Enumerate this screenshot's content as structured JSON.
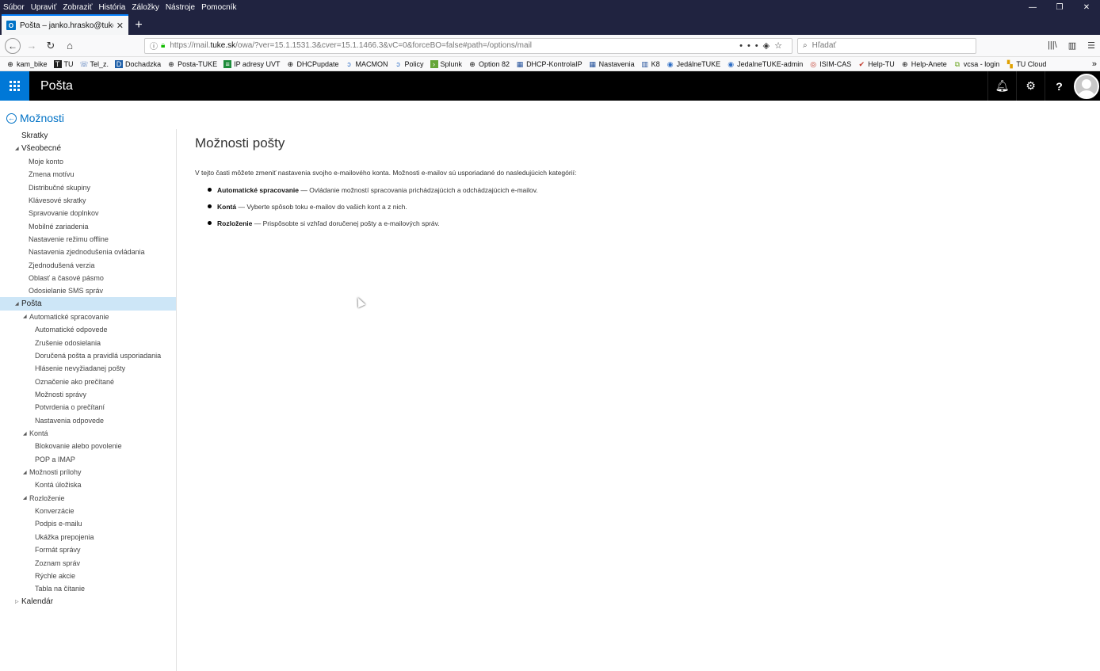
{
  "menubar": {
    "items": [
      "Súbor",
      "Upraviť",
      "Zobraziť",
      "História",
      "Záložky",
      "Nástroje",
      "Pomocník"
    ]
  },
  "tab": {
    "title": "Pošta – janko.hrasko@tuke.sk",
    "favicon": "O"
  },
  "address": {
    "url_pre": "https://mail.",
    "url_domain": "tuke.sk",
    "url_post": "/owa/?ver=15.1.1531.3&cver=15.1.1466.3&vC=0&forceBO=false#path=/options/mail"
  },
  "search": {
    "placeholder": "Hľadať"
  },
  "bookmarks": [
    "kam_bike",
    "TU",
    "Tel_z.",
    "Dochadzka",
    "Posta-TUKE",
    "IP adresy UVT",
    "DHCPupdate",
    "MACMON",
    "Policy",
    "Splunk",
    "Option 82",
    "DHCP-KontrolaIP",
    "Nastavenia",
    "K8",
    "JedálneTUKE",
    "JedalneTUKE-admin",
    "ISIM-CAS",
    "Help-TU",
    "Help-Anete",
    "vcsa - login",
    "TU Cloud"
  ],
  "owa": {
    "app_title": "Pošta",
    "back_label": "Možnosti"
  },
  "nav": {
    "skratky": "Skratky",
    "vseobecne": "Všeobecné",
    "vseobecne_items": [
      "Moje konto",
      "Zmena motívu",
      "Distribučné skupiny",
      "Klávesové skratky",
      "Spravovanie doplnkov",
      "Mobilné zariadenia",
      "Nastavenie režimu offline",
      "Nastavenia zjednodušenia ovládania",
      "Zjednodušená verzia",
      "Oblasť a časové pásmo",
      "Odosielanie SMS správ"
    ],
    "posta": "Pošta",
    "auto": "Automatické spracovanie",
    "auto_items": [
      "Automatické odpovede",
      "Zrušenie odosielania",
      "Doručená pošta a pravidlá usporiadania",
      "Hlásenie nevyžiadanej pošty",
      "Označenie ako prečítané",
      "Možnosti správy",
      "Potvrdenia o prečítaní",
      "Nastavenia odpovede"
    ],
    "konta": "Kontá",
    "konta_items": [
      "Blokovanie alebo povolenie",
      "POP a IMAP"
    ],
    "priloha": "Možnosti prílohy",
    "priloha_items": [
      "Kontá úložiska"
    ],
    "rozlozenie": "Rozloženie",
    "rozlozenie_items": [
      "Konverzácie",
      "Podpis e-mailu",
      "Ukážka prepojenia",
      "Formát správy",
      "Zoznam správ",
      "Rýchle akcie",
      "Tabla na čítanie"
    ],
    "kalendar": "Kalendár"
  },
  "content": {
    "title": "Možnosti pošty",
    "intro": "V tejto časti môžete zmeniť nastavenia svojho e-mailového konta. Možnosti e-mailov sú usporiadané do nasledujúcich kategórií:",
    "items": [
      {
        "term": "Automatické spracovanie",
        "desc": " — Ovládanie možností spracovania prichádzajúcich a odchádzajúcich e-mailov."
      },
      {
        "term": "Kontá",
        "desc": " — Vyberte spôsob toku e-mailov do vašich kont a z nich."
      },
      {
        "term": "Rozloženie",
        "desc": " — Prispôsobte si vzhľad doručenej pošty a e-mailových správ."
      }
    ]
  },
  "colors": {
    "accent": "#0078d7",
    "link": "#0072c6",
    "selected": "#cde6f7"
  }
}
